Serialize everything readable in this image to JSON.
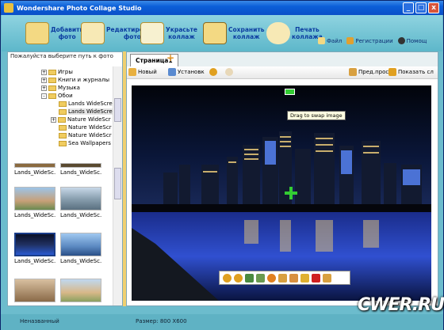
{
  "window": {
    "title": "Wondershare Photo Collage Studio",
    "minimize": "_",
    "maximize": "□",
    "close": "x"
  },
  "toolbar": {
    "buttons": [
      {
        "label": "Добавить\nфото",
        "icon": "add-photo-icon"
      },
      {
        "label": "Редактировать\nфото",
        "icon": "edit-photo-icon"
      },
      {
        "label": "Украсьте\nколлаж",
        "icon": "decorate-icon"
      },
      {
        "label": "Сохранить\nколлаж",
        "icon": "save-icon"
      },
      {
        "label": "Печать\nколлажа",
        "icon": "print-icon"
      }
    ],
    "secondary": {
      "file": "Файл",
      "register": "Регистрации",
      "help": "Помощ"
    }
  },
  "left_panel": {
    "header": "Пожалуйста выберите путь к фото",
    "tree": [
      {
        "label": "Игры",
        "expander": "+"
      },
      {
        "label": "Книги и журналы",
        "expander": "+"
      },
      {
        "label": "Музыка",
        "expander": "+"
      },
      {
        "label": "Обои",
        "expander": "-"
      },
      {
        "label": "Lands WideScre",
        "expander": ""
      },
      {
        "label": "Lands WideScre",
        "expander": ""
      },
      {
        "label": "Nature WideScr",
        "expander": "+"
      },
      {
        "label": "Nature WideScr",
        "expander": ""
      },
      {
        "label": "Nature WideScr",
        "expander": ""
      },
      {
        "label": "Sea Wallpapers",
        "expander": ""
      }
    ],
    "thumbnails": [
      "Lands_WideSc...",
      "Lands_WideSc...",
      "Lands_WideSc...",
      "Lands_WideSc...",
      "Lands_WideSc...",
      "Lands_WideSc...",
      "",
      ""
    ]
  },
  "right_panel": {
    "tab": "Страница1",
    "add_tab": "+",
    "canvas_tools": {
      "new": "Новый",
      "settings": "Установк",
      "prev_view": "Пред.прос",
      "show": "Показать сл"
    },
    "tooltip": "Drag to swap image"
  },
  "status": {
    "left": "Неназванный",
    "size": "Размер:  800 X600"
  },
  "watermark": "CWER.RU",
  "colors": {
    "accent": "#0b3ca0",
    "app_bg": "#6cbccd",
    "titlebar": "#0b5fd8",
    "splitter": "#f0d070"
  }
}
